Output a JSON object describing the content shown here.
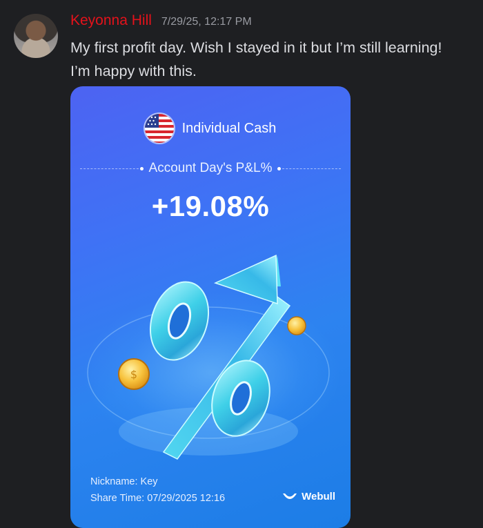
{
  "message": {
    "author": "Keyonna Hill",
    "timestamp": "7/29/25, 12:17 PM",
    "text": "My first profit day. Wish I stayed in it but I’m still learning! I’m happy with this.",
    "author_color": "#e4121b"
  },
  "share_card": {
    "account_name": "Individual Cash",
    "metric_label": "Account Day's P&L%",
    "metric_value": "+19.08%",
    "nickname": "Nickname: Key",
    "share_time": "Share Time: 07/29/2025 12:16",
    "brand": "Webull",
    "flag_icon": "us-flag-icon",
    "art_icon": "percent-arrow-illustration"
  }
}
